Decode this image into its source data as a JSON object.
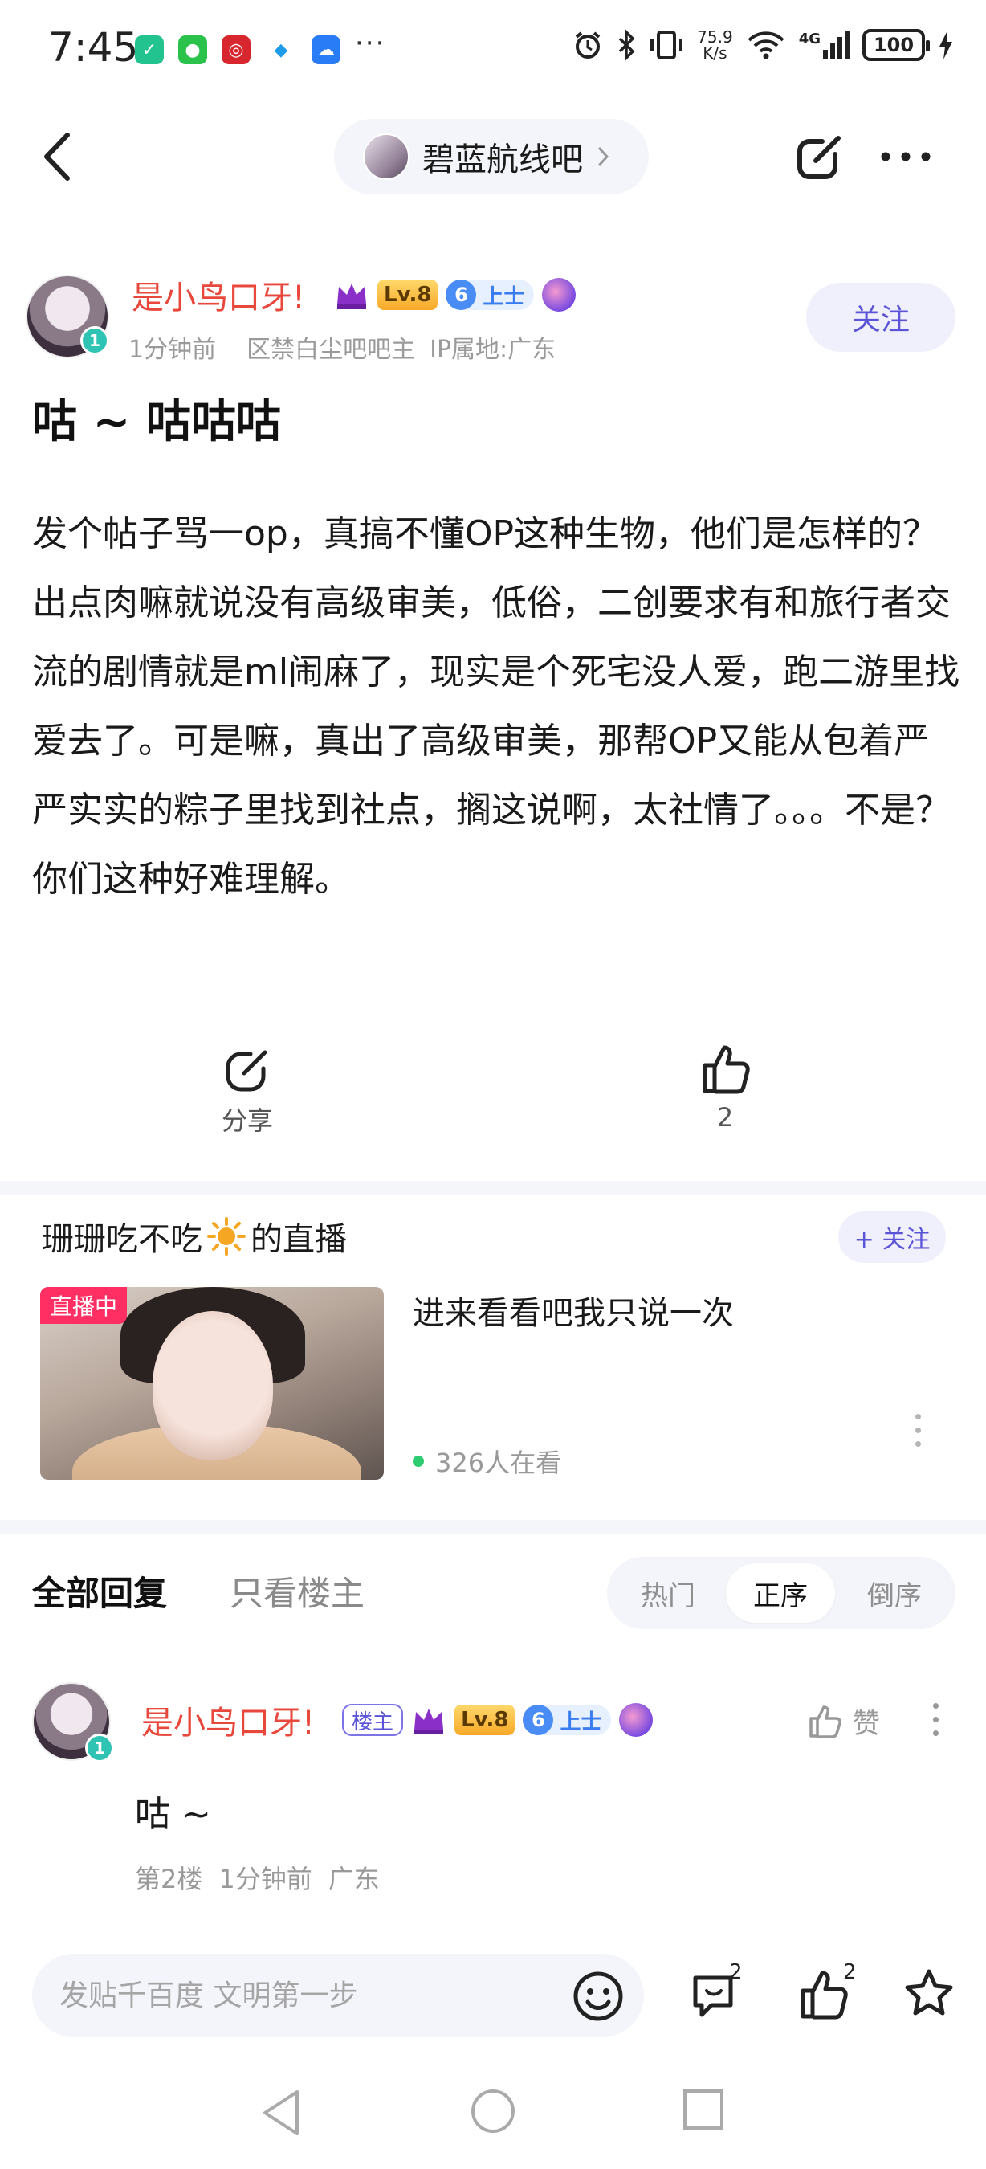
{
  "status_bar": {
    "time": "7:45",
    "more": "···",
    "net_speed_value": "75.9",
    "net_speed_unit": "K/s",
    "network": "4G",
    "battery": "100"
  },
  "header": {
    "forum_name": "碧蓝航线吧"
  },
  "post": {
    "author": "是小鸟口牙!",
    "level": "Lv.8",
    "rank_num": "6",
    "rank_title": "上士",
    "avatar_badge": "1",
    "time": "1分钟前",
    "role": "区禁白尘吧吧主",
    "ip": "IP属地:广东",
    "follow_label": "关注",
    "title": "咕 ~ 咕咕咕",
    "body": "发个帖子骂一op，真搞不懂OP这种生物，他们是怎样的？出点肉嘛就说没有高级审美，低俗，二创要求有和旅行者交流的剧情就是ml闹麻了，现实是个死宅没人爱，跑二游里找爱去了。可是嘛，真出了高级审美，那帮OP又能从包着严严实实的粽子里找到社点，搁这说啊，太社情了。。。不是？你们这种好难理解。",
    "share_label": "分享",
    "like_count": "2"
  },
  "live": {
    "title_prefix": "珊珊吃不吃",
    "title_suffix": "的直播",
    "follow_label": "+ 关注",
    "tag": "直播中",
    "headline": "进来看看吧我只说一次",
    "viewers": "326人在看"
  },
  "replies": {
    "tab_all": "全部回复",
    "tab_op_only": "只看楼主",
    "sort_options": [
      "热门",
      "正序",
      "倒序"
    ],
    "sort_active": "正序",
    "items": [
      {
        "author": "是小鸟口牙!",
        "tag": "楼主",
        "level": "Lv.8",
        "rank_num": "6",
        "rank_title": "上士",
        "avatar_badge": "1",
        "like_label": "赞",
        "text": "咕 ~",
        "floor": "第2楼",
        "time": "1分钟前",
        "location": "广东"
      }
    ]
  },
  "bottom_bar": {
    "input_placeholder": "发贴千百度 文明第一步",
    "comment_count": "2",
    "like_count": "2"
  },
  "colors": {
    "accent": "#5b54d8",
    "author_name": "#e8473c",
    "live_tag": "#ff2e63",
    "level_badge": "#f7a928",
    "rank_badge": "#4a8cf5"
  }
}
